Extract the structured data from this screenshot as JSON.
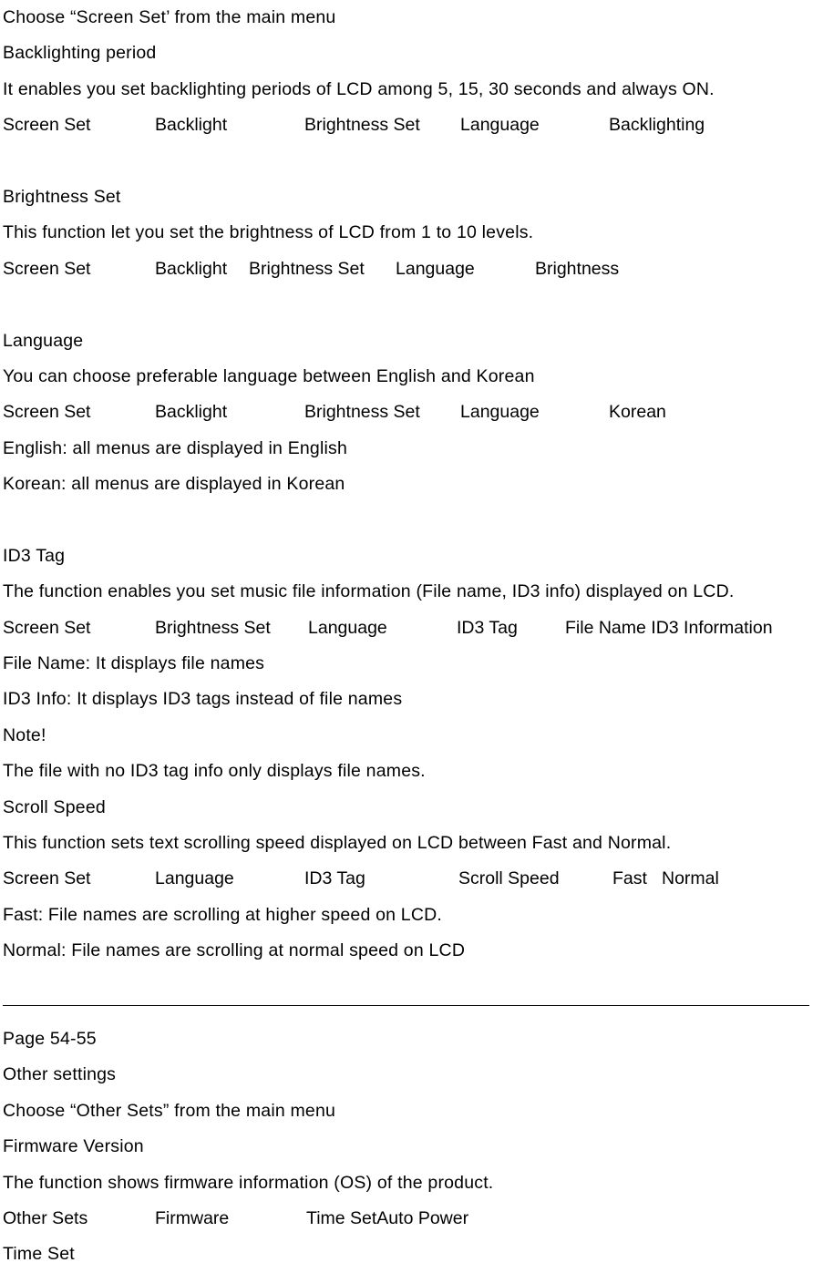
{
  "document": {
    "type": "user-manual-excerpt",
    "page_label": "Page 54-55",
    "divider_color": "#000000",
    "text_color": "#000000",
    "background_color": "#ffffff"
  },
  "sections": {
    "screen_set_intro": {
      "line": "Choose “Screen Set’ from the main menu"
    },
    "backlighting": {
      "heading": "Backlighting period",
      "description": "It enables you set backlighting periods of LCD among 5, 15, 30 seconds and always ON.",
      "path": [
        "Screen Set",
        "Backlight",
        "Brightness Set",
        "Language",
        "Backlighting"
      ]
    },
    "brightness": {
      "heading": "Brightness Set",
      "description": "This function let you set the brightness of LCD from 1 to 10 levels.",
      "path": [
        "Screen Set",
        "Backlight",
        "Brightness Set",
        "Language",
        "Brightness"
      ]
    },
    "language": {
      "heading": "Language",
      "description": "You can choose preferable language between English and Korean",
      "path": [
        "Screen Set",
        "Backlight",
        "Brightness Set",
        "Language",
        "Korean"
      ],
      "note_english": "English: all menus are displayed in English",
      "note_korean": "Korean: all menus are displayed in Korean"
    },
    "id3_tag": {
      "heading": "ID3 Tag",
      "description": "The function enables you set music file information (File name, ID3 info) displayed on LCD.",
      "path": [
        "Screen Set",
        "Brightness Set",
        "Language",
        "ID3 Tag",
        "File Name ID3 Information"
      ],
      "note_file_name": "File Name: It displays file names",
      "note_id3_info": "ID3 Info: It displays ID3 tags instead of file names",
      "note_label": "Note!",
      "note_body": "The file with no ID3 tag info only displays file names."
    },
    "scroll_speed": {
      "heading": "Scroll Speed",
      "description": "This function sets text scrolling speed displayed on LCD between Fast and Normal.",
      "path": [
        "Screen Set",
        "Language",
        "ID3 Tag",
        "Scroll Speed",
        "Fast",
        "Normal"
      ],
      "note_fast": "Fast: File names are scrolling at higher speed on LCD.",
      "note_normal": "Normal: File names are scrolling at normal speed on LCD"
    },
    "other_settings": {
      "page_label": "Page 54-55",
      "heading": "Other settings",
      "intro": "Choose “Other Sets” from the main menu",
      "firmware_heading": "Firmware Version",
      "firmware_description": "The function shows firmware information (OS) of the product.",
      "path": [
        "Other Sets",
        "Firmware",
        "Time SetAuto Power"
      ],
      "time_set_heading": "Time Set"
    }
  }
}
